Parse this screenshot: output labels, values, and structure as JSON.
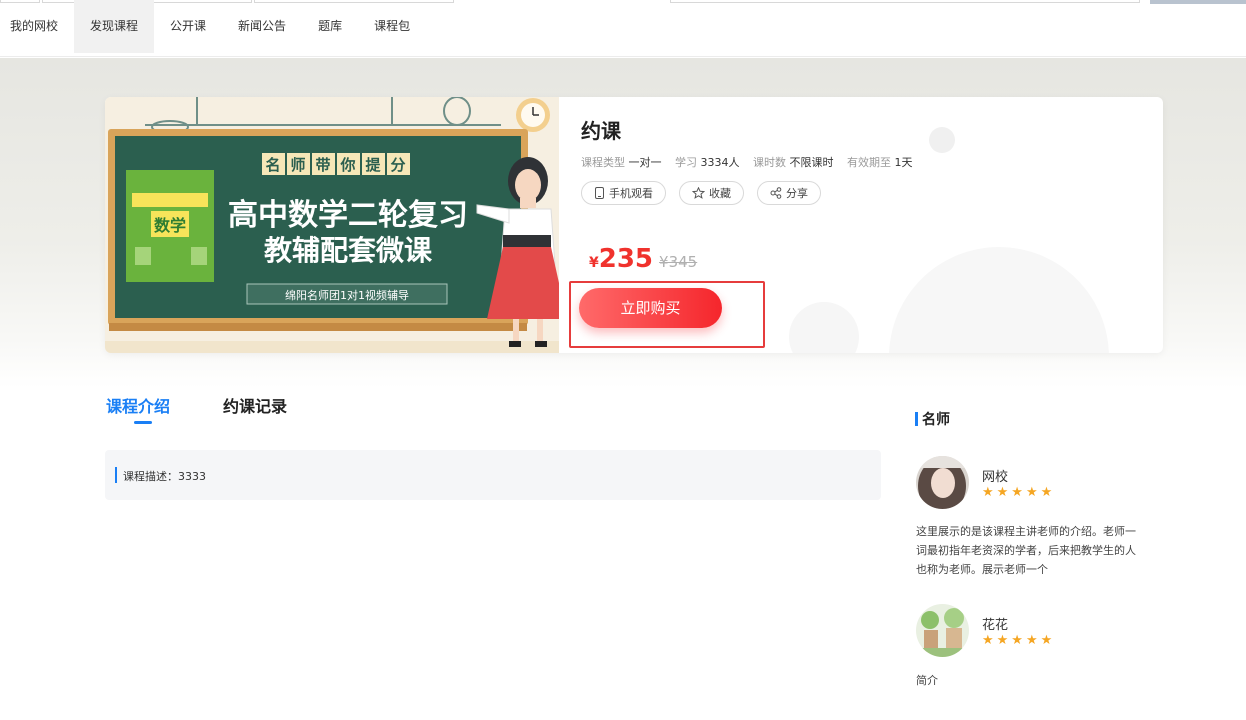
{
  "nav": {
    "items": [
      "我的网校",
      "发现课程",
      "公开课",
      "新闻公告",
      "题库",
      "课程包"
    ],
    "active_index": 1
  },
  "cover": {
    "tag_chars": [
      "名",
      "师",
      "带",
      "你",
      "提",
      "分"
    ],
    "title_line1": "高中数学二轮复习",
    "title_line2": "教辅配套微课",
    "subtitle": "绵阳名师团1对1视频辅导",
    "book_label": "数学"
  },
  "course": {
    "title": "约课",
    "meta": [
      {
        "label": "课程类型",
        "value": "一对一"
      },
      {
        "label": "学习",
        "value": "3334人"
      },
      {
        "label": "课时数",
        "value": "不限课时"
      },
      {
        "label": "有效期至",
        "value": "1天"
      }
    ],
    "actions": [
      {
        "icon": "phone-icon",
        "label": "手机观看"
      },
      {
        "icon": "star-outline-icon",
        "label": "收藏"
      },
      {
        "icon": "share-icon",
        "label": "分享"
      }
    ],
    "currency": "¥",
    "price": "235",
    "original_price": "¥345",
    "buy_label": "立即购买"
  },
  "tabs": [
    "课程介绍",
    "约课记录"
  ],
  "description": "课程描述：3333",
  "teachers_section": {
    "title": "名师",
    "teachers": [
      {
        "name": "网校",
        "stars": "★★★★★",
        "rating": 5,
        "desc": "这里展示的是该课程主讲老师的介绍。老师一词最初指年老资深的学者，后来把教学生的人也称为老师。展示老师一个"
      },
      {
        "name": "花花",
        "stars": "★★★★★",
        "rating": 5,
        "desc": "简介"
      }
    ]
  },
  "colors": {
    "accent": "#1a7ff5",
    "price": "#f0322d",
    "star": "#f5a623",
    "chalkboard": "#2b5f4f"
  }
}
